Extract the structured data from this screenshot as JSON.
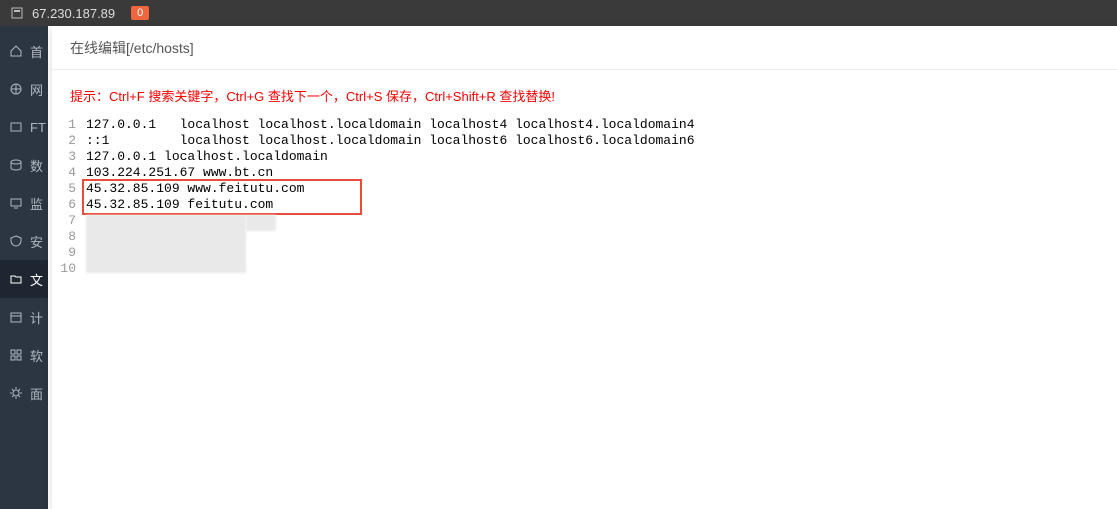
{
  "topbar": {
    "ip": "67.230.187.89",
    "badge": "0"
  },
  "sidebar": {
    "items": [
      {
        "label": "首"
      },
      {
        "label": "网"
      },
      {
        "label": "FT"
      },
      {
        "label": "数"
      },
      {
        "label": "监"
      },
      {
        "label": "安"
      },
      {
        "label": "文"
      },
      {
        "label": "计"
      },
      {
        "label": "软"
      },
      {
        "label": "面"
      }
    ]
  },
  "modal": {
    "title": "在线编辑[/etc/hosts]",
    "hint": "提示：Ctrl+F 搜索关键字，Ctrl+G 查找下一个，Ctrl+S 保存，Ctrl+Shift+R 查找替换!"
  },
  "editor": {
    "lines": [
      "127.0.0.1   localhost localhost.localdomain localhost4 localhost4.localdomain4",
      "::1         localhost localhost.localdomain localhost6 localhost6.localdomain6",
      "127.0.0.1 localhost.localdomain",
      "103.224.251.67 www.bt.cn",
      "45.32.85.109 www.feitutu.com",
      "45.32.85.109 feitutu.com",
      "",
      "",
      "",
      ""
    ],
    "highlight": {
      "startLine": 5,
      "endLine": 6
    }
  }
}
